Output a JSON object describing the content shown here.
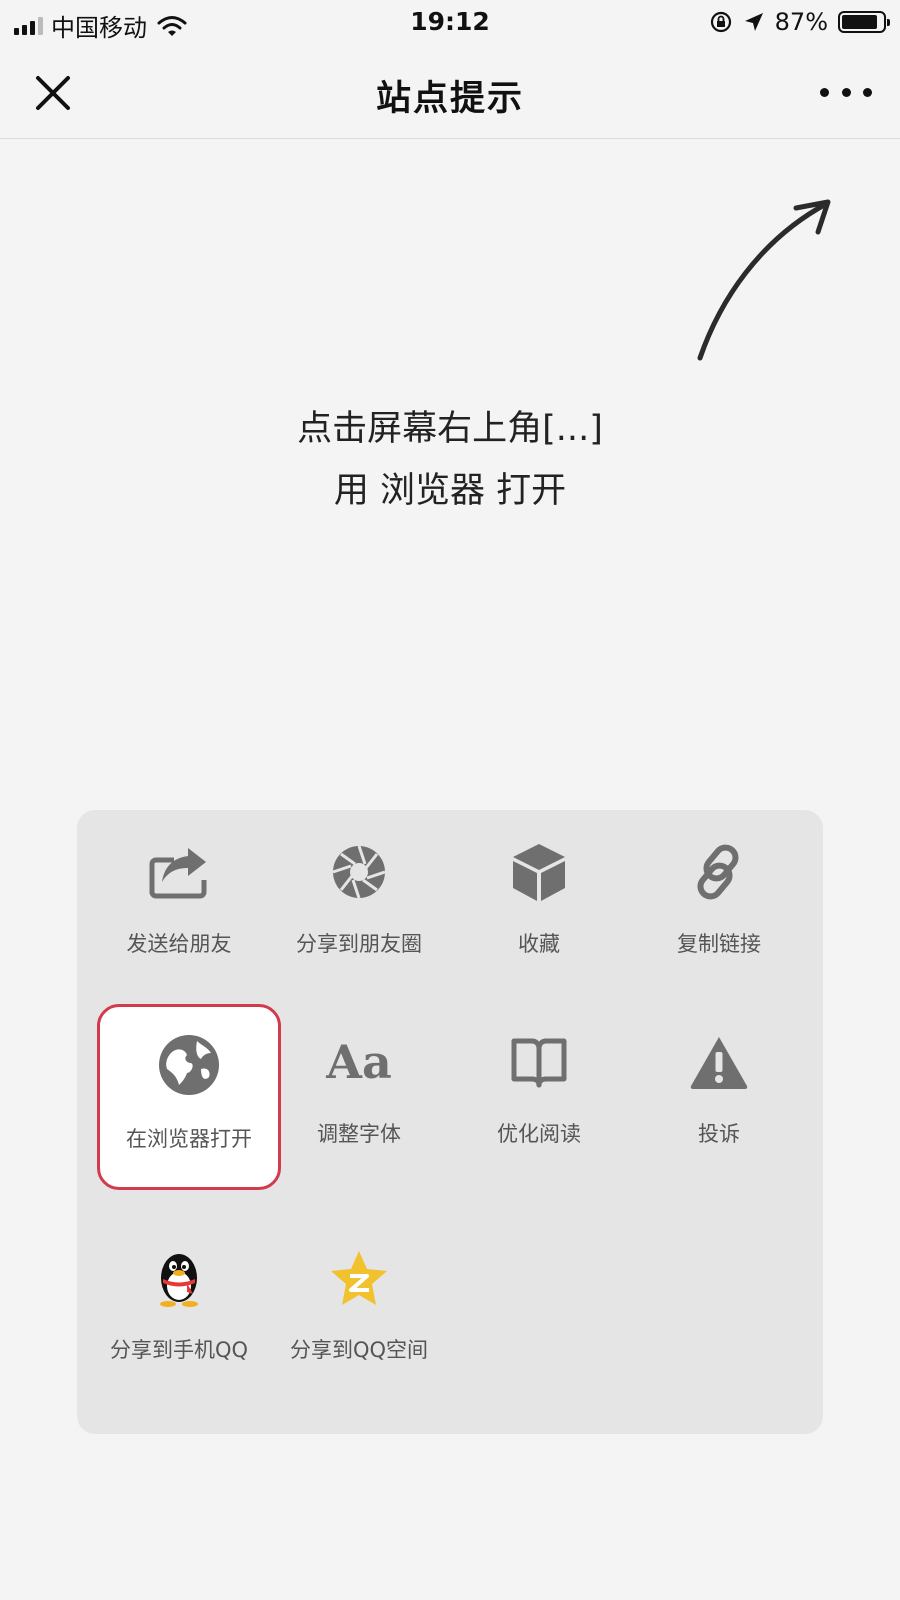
{
  "status_bar": {
    "carrier": "中国移动",
    "time": "19:12",
    "battery_percent": "87%",
    "battery_level": 0.87,
    "icons": [
      "signal-icon",
      "wifi-icon",
      "rotation-lock-icon",
      "location-icon",
      "battery-icon"
    ]
  },
  "nav": {
    "title": "站点提示",
    "left_icon": "close-icon",
    "right_icon": "more-icon"
  },
  "hint": {
    "line1": "点击屏幕右上角[...]",
    "line2": "用 浏览器 打开"
  },
  "menu": {
    "row1": [
      {
        "label": "发送给朋友",
        "icon": "forward-icon"
      },
      {
        "label": "分享到朋友圈",
        "icon": "moments-icon"
      },
      {
        "label": "收藏",
        "icon": "favorite-cube-icon"
      },
      {
        "label": "复制链接",
        "icon": "link-icon"
      }
    ],
    "row2": [
      {
        "label": "在浏览器打开",
        "icon": "globe-icon",
        "highlighted": true
      },
      {
        "label": "调整字体",
        "icon": "font-size-icon",
        "glyph": "Aa"
      },
      {
        "label": "优化阅读",
        "icon": "book-icon"
      },
      {
        "label": "投诉",
        "icon": "warning-icon"
      }
    ],
    "row3": [
      {
        "label": "分享到手机QQ",
        "icon": "qq-penguin-icon"
      },
      {
        "label": "分享到QQ空间",
        "icon": "qzone-star-icon"
      }
    ]
  },
  "colors": {
    "background": "#f4f4f4",
    "panel": "#e5e5e5",
    "icon_gray": "#6f6f6f",
    "highlight_border": "#d23b4c",
    "qzone_yellow": "#f2c12e"
  }
}
